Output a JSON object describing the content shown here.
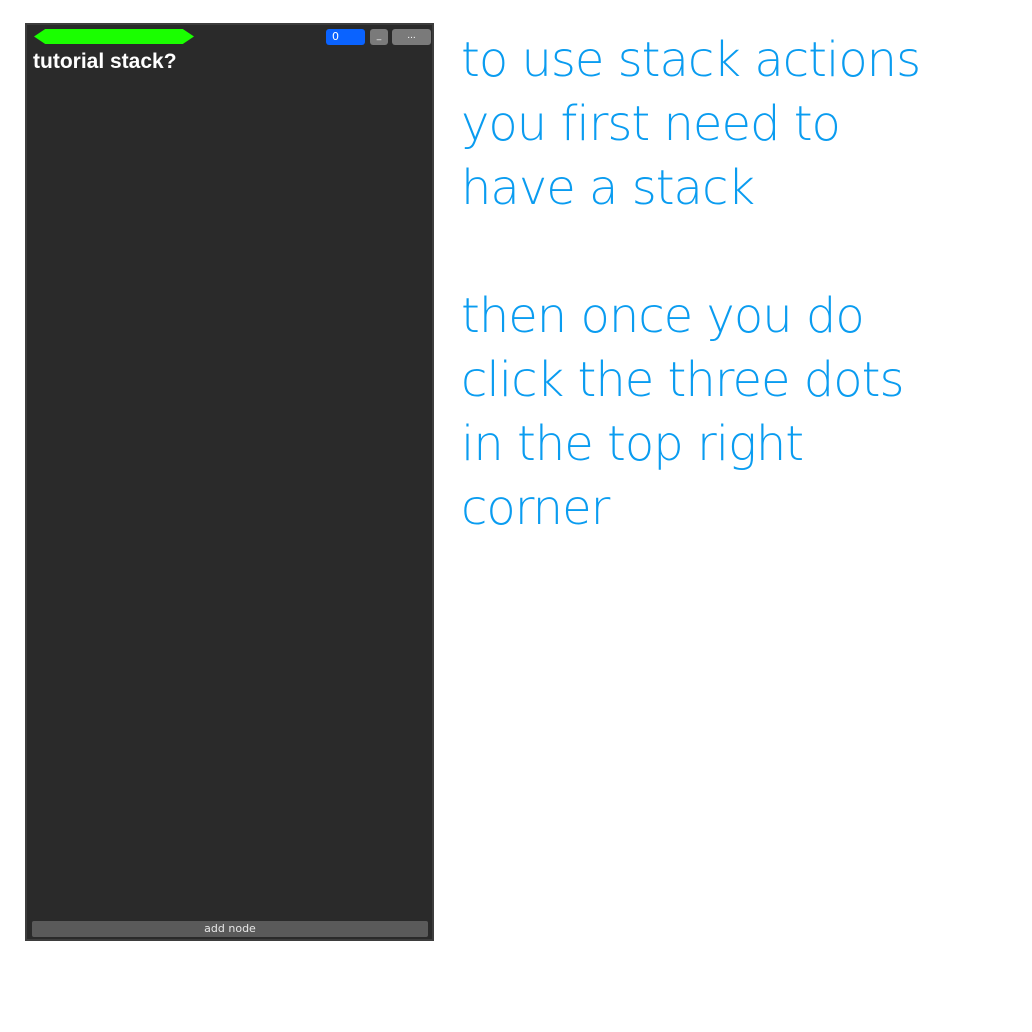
{
  "stack": {
    "title": "tutorial stack?",
    "counter_value": "0",
    "minimize_label": "_",
    "more_label": "...",
    "add_node_label": "add node"
  },
  "instructions": {
    "paragraph1": [
      "to use stack actions",
      "you first need to",
      "have a stack"
    ],
    "paragraph2": [
      "then once you do",
      "click the three dots",
      "in the top right",
      "corner"
    ]
  },
  "colors": {
    "panel_bg": "#2a2a2a",
    "handle": "#1aff00",
    "counter": "#0a63ff",
    "buttons": "#7a7a7a",
    "instruction_text": "#0a9cf0"
  }
}
